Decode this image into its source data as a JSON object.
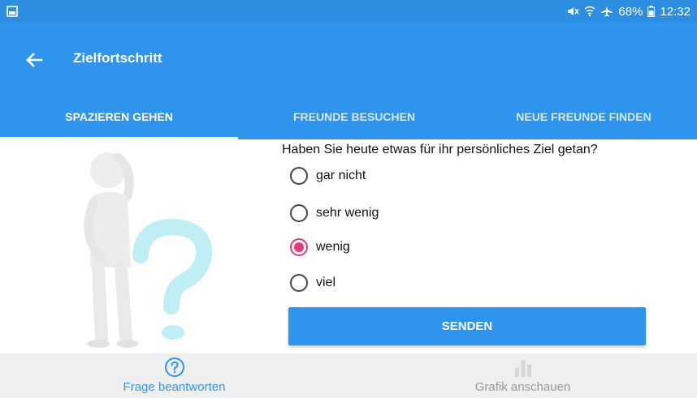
{
  "status_bar": {
    "battery": "68%",
    "time": "12:32"
  },
  "app_bar": {
    "title": "Zielfortschritt"
  },
  "tabs": [
    {
      "label": "SPAZIEREN GEHEN",
      "active": true
    },
    {
      "label": "FREUNDE BESUCHEN",
      "active": false
    },
    {
      "label": "NEUE FREUNDE FINDEN",
      "active": false
    }
  ],
  "question": "Haben Sie heute etwas für ihr persönliches Ziel getan?",
  "options": [
    {
      "label": "gar nicht",
      "checked": false
    },
    {
      "label": "sehr wenig",
      "checked": false
    },
    {
      "label": "wenig",
      "checked": true
    },
    {
      "label": "viel",
      "checked": false
    }
  ],
  "send_label": "SENDEN",
  "bottom_nav": [
    {
      "label": "Frage beantworten",
      "icon": "question-circle-icon",
      "active": true
    },
    {
      "label": "Grafik anschauen",
      "icon": "bar-chart-icon",
      "active": false
    }
  ],
  "colors": {
    "primary": "#2f95ec",
    "status_bar": "#2d8de0",
    "accent": "#e83a73"
  }
}
